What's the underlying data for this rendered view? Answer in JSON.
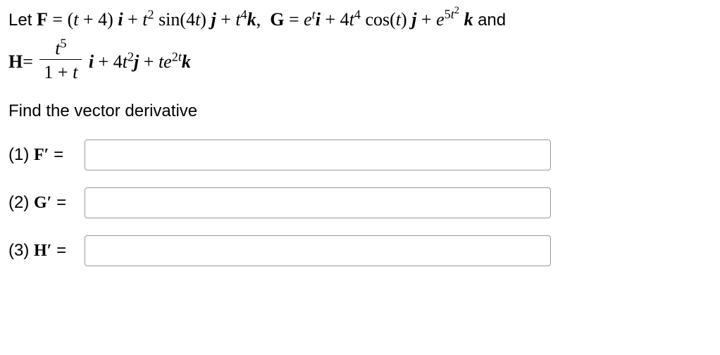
{
  "preamble_let": "Let ",
  "and_text": " and",
  "instruction": "Find the vector derivative",
  "labels": {
    "q1_prefix": "(1) ",
    "q1_vec": "F′",
    "q2_prefix": "(2) ",
    "q2_vec": "G′",
    "q3_prefix": "(3) ",
    "q3_vec": "H′",
    "equals": " ="
  },
  "eq": {
    "F_symbol": "F",
    "eq": " = ",
    "F_rhs_a": "(",
    "F_rhs_b": "t",
    "F_rhs_c": " + 4) ",
    "i": "i",
    "j": "j",
    "k": "k",
    "plus": " + ",
    "t2": "t",
    "two": "2",
    "sin4t": " sin(4",
    "sin4t_b": ") ",
    "t4": "t",
    "four": "4",
    "G_symbol": "G",
    "e": "e",
    "t_sup": "t",
    "fourt4": "4",
    "cosb": " cos(",
    "closep": ") ",
    "five_t2": "5",
    "H_symbol": "H",
    "t5": "t",
    "five": "5",
    "oneplus_t": "1 + ",
    "hj": "4",
    "te": "te",
    "twot": "2t"
  },
  "inputs": {
    "f_value": "",
    "g_value": "",
    "h_value": ""
  }
}
